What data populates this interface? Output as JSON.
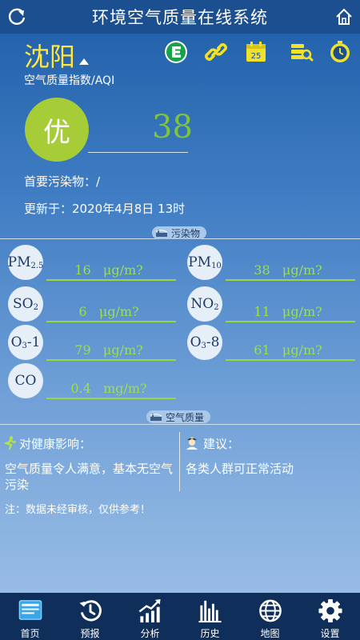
{
  "header": {
    "title": "环境空气质量在线系统"
  },
  "city": {
    "name": "沈阳"
  },
  "aqi": {
    "label": "空气质量指数/AQI",
    "grade": "优",
    "value": "38",
    "primary_pollutant": "首要污染物：/",
    "update_time": "更新于：2020年4月8日 13时"
  },
  "sections": {
    "pollutants_tag": "污染物",
    "air_quality_tag": "空气质量"
  },
  "pollutants": [
    {
      "name": "PM",
      "sub": "2.5",
      "value": "16",
      "unit": "μg/m?"
    },
    {
      "name": "PM",
      "sub": "10",
      "value": "38",
      "unit": "μg/m?"
    },
    {
      "name": "SO",
      "sub": "2",
      "value": "6",
      "unit": "μg/m?"
    },
    {
      "name": "NO",
      "sub": "2",
      "value": "11",
      "unit": "μg/m?"
    },
    {
      "name": "O",
      "sub": "3",
      "suffix": "-1",
      "value": "79",
      "unit": "μg/m?"
    },
    {
      "name": "O",
      "sub": "3",
      "suffix": "-8",
      "value": "61",
      "unit": "μg/m?"
    },
    {
      "name": "CO",
      "sub": "",
      "value": "0.4",
      "unit": "mg/m?"
    }
  ],
  "health": {
    "title": "对健康影响：",
    "text": "空气质量令人满意，基本无空气污染"
  },
  "advice": {
    "title": "建议：",
    "text": "各类人群可正常活动"
  },
  "note": "注：数据未经审核，仅供参考！",
  "tabs": [
    {
      "label": "首页"
    },
    {
      "label": "预报"
    },
    {
      "label": "分析"
    },
    {
      "label": "历史"
    },
    {
      "label": "地图"
    },
    {
      "label": "设置"
    }
  ],
  "calendar_day": "25",
  "colors": {
    "accent_yellow": "#ffe640",
    "grade_green": "#a6cc38",
    "value_green": "#9be04a",
    "tabbar": "#0f2f5a"
  }
}
